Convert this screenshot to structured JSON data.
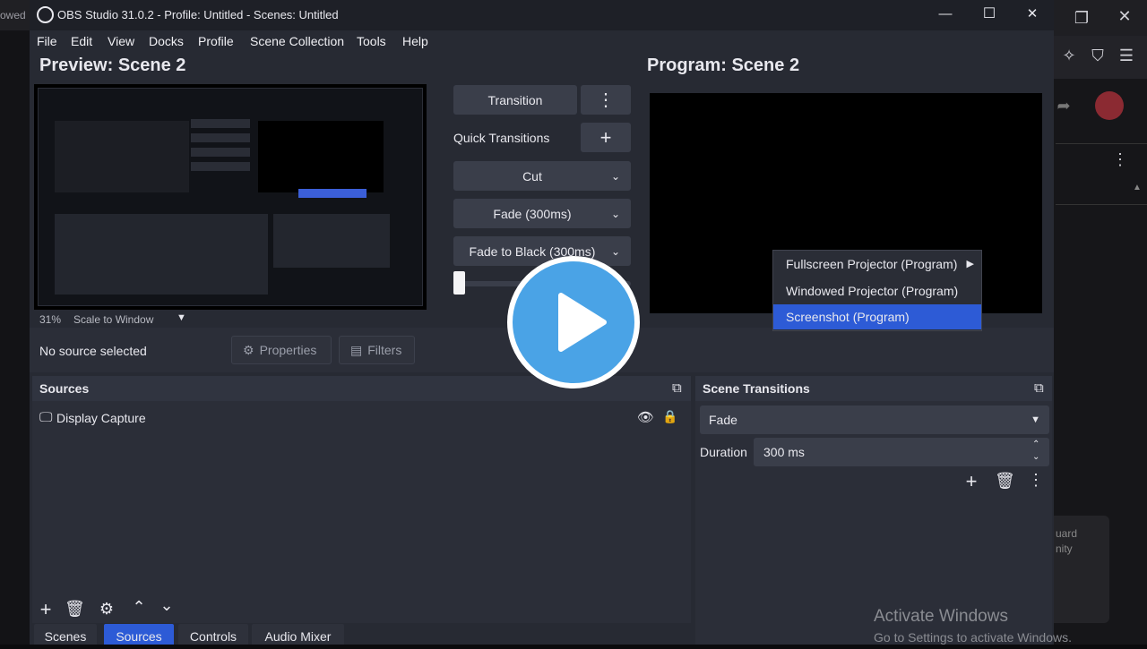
{
  "background": {
    "left_tab_text": "owed",
    "right_partial_text_1": "uard",
    "right_partial_text_2": "nity"
  },
  "window": {
    "title": "OBS Studio 31.0.2 - Profile: Untitled - Scenes: Untitled",
    "controls": [
      "minimize",
      "maximize",
      "close"
    ]
  },
  "menu": [
    "File",
    "Edit",
    "View",
    "Docks",
    "Profile",
    "Scene Collection",
    "Tools",
    "Help"
  ],
  "preview": {
    "title": "Preview: Scene 2",
    "zoom": "31%",
    "scale_mode": "Scale to Window"
  },
  "program": {
    "title": "Program: Scene 2"
  },
  "transitions_panel": {
    "transition_button": "Transition",
    "quick_transitions_label": "Quick Transitions",
    "quick_items": [
      "Cut",
      "Fade (300ms)",
      "Fade to Black (300ms)"
    ]
  },
  "context_menu": {
    "items": [
      "Fullscreen Projector (Program)",
      "Windowed Projector (Program)",
      "Screenshot (Program)"
    ],
    "highlighted_index": 2
  },
  "toolbar": {
    "status": "No source selected",
    "properties": "Properties",
    "filters": "Filters"
  },
  "sources_dock": {
    "title": "Sources",
    "items": [
      {
        "name": "Display Capture"
      }
    ]
  },
  "scene_transitions_dock": {
    "title": "Scene Transitions",
    "selected": "Fade",
    "duration_label": "Duration",
    "duration_value": "300 ms"
  },
  "bottom_tabs": [
    "Scenes",
    "Sources",
    "Controls",
    "Audio Mixer"
  ],
  "active_tab": "Sources",
  "watermark": {
    "line1": "Activate Windows",
    "line2": "Go to Settings to activate Windows."
  },
  "colors": {
    "accent": "#2d5bd6",
    "play": "#4aa3e6",
    "panel": "#2b2e38",
    "button": "#3a3e4a"
  }
}
